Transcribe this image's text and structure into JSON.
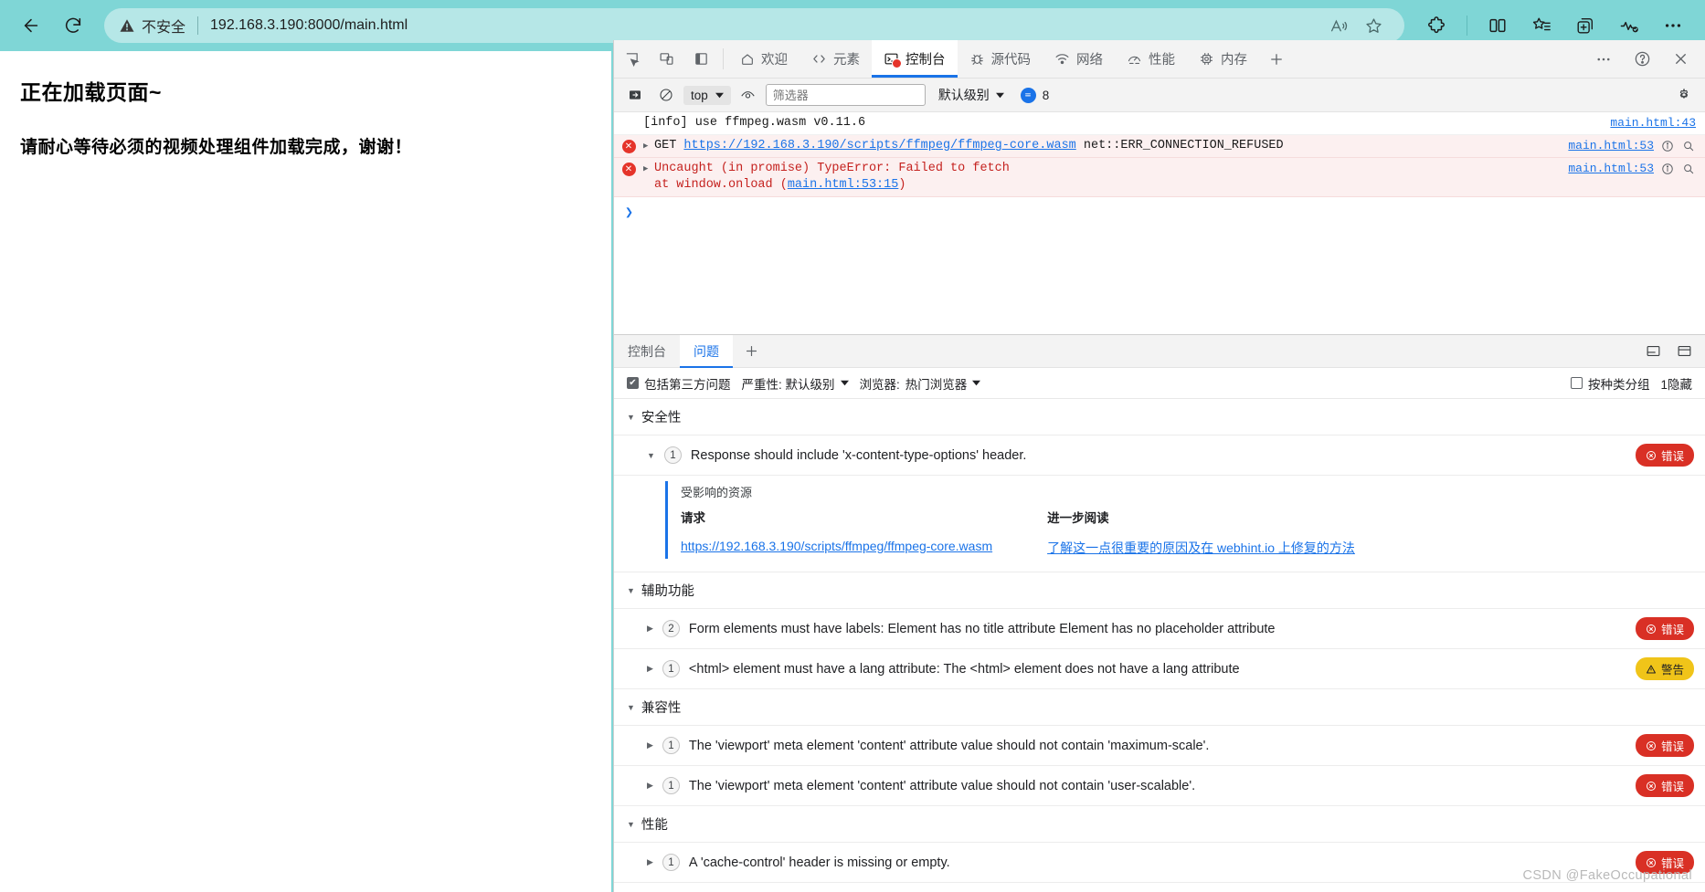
{
  "browser": {
    "back_label": "back-arrow",
    "reload_label": "reload",
    "security_text": "不安全",
    "url": "192.168.3.190:8000/main.html",
    "read_aloud_icon": "read-aloud-icon",
    "favorite_icon": "star-icon",
    "toolbar_icons": [
      "extensions-icon",
      "split-screen-icon",
      "favorites-list-icon",
      "collections-icon",
      "browser-essentials-icon",
      "more-options-icon"
    ]
  },
  "page": {
    "heading": "正在加载页面~",
    "subheading": "请耐心等待必须的视频处理组件加载完成，谢谢！"
  },
  "devtools": {
    "left_icons": [
      "inspect-icon",
      "device-toolbar-icon",
      "dock-side-icon"
    ],
    "tabs": [
      {
        "label": "欢迎",
        "icon": "home-icon",
        "active": false
      },
      {
        "label": "元素",
        "icon": "code-icon",
        "active": false
      },
      {
        "label": "控制台",
        "icon": "console-icon",
        "active": true,
        "error": true
      },
      {
        "label": "源代码",
        "icon": "bug-icon",
        "active": false
      },
      {
        "label": "网络",
        "icon": "network-icon",
        "active": false
      },
      {
        "label": "性能",
        "icon": "performance-icon",
        "active": false
      },
      {
        "label": "内存",
        "icon": "memory-icon",
        "active": false
      }
    ],
    "add_tab": "+",
    "more_tools": "more-tools-icon",
    "help": "help-icon",
    "close": "close-icon"
  },
  "console_toolbar": {
    "sidebar_toggle": "console-sidebar-icon",
    "clear": "clear-console-icon",
    "context": "top",
    "eye": "live-expression-icon",
    "filter_placeholder": "筛选器",
    "filter_value": "",
    "level": "默认级别",
    "info_count": "8",
    "settings": "settings-gear-icon"
  },
  "console_messages": [
    {
      "type": "info",
      "text": "[info] use ffmpeg.wasm v0.11.6",
      "source": "main.html:43",
      "expandable": false
    },
    {
      "type": "error",
      "prefix": "GET ",
      "link": "https://192.168.3.190/scripts/ffmpeg/ffmpeg-core.wasm",
      "suffix": " net::ERR_CONNECTION_REFUSED",
      "source": "main.html:53",
      "expandable": true
    },
    {
      "type": "error",
      "text": "Uncaught (in promise) TypeError: Failed to fetch",
      "sub_prefix": "    at window.onload (",
      "sub_link": "main.html:53:15",
      "sub_suffix": ")",
      "source": "main.html:53",
      "expandable": true
    }
  ],
  "drawer": {
    "tabs": [
      {
        "label": "控制台",
        "active": false
      },
      {
        "label": "问题",
        "active": true
      }
    ],
    "add_tab": "+",
    "right_icons": [
      "dock-bottom-icon",
      "dock-right-icon"
    ]
  },
  "issues_filter": {
    "third_party_label": "包括第三方问题",
    "third_party_checked": true,
    "severity_label": "严重性: 默认级别",
    "browser_label": "浏览器:",
    "browser_value": "热门浏览器",
    "group_by_kind_label": "按种类分组",
    "group_by_kind_checked": false,
    "hidden_label": "1隐藏"
  },
  "issues": [
    {
      "category": "安全性",
      "rows": [
        {
          "count": "1",
          "text": "Response should include 'x-content-type-options' header.",
          "badge": "错误",
          "badge_type": "error",
          "expanded": true,
          "detail": {
            "affected_label": "受影响的资源",
            "col1_head": "请求",
            "col1_link": "https://192.168.3.190/scripts/ffmpeg/ffmpeg-core.wasm",
            "col2_head": "进一步阅读",
            "col2_link": "了解这一点很重要的原因及在 webhint.io 上修复的方法"
          }
        }
      ]
    },
    {
      "category": "辅助功能",
      "rows": [
        {
          "count": "2",
          "text": "Form elements must have labels: Element has no title attribute Element has no placeholder attribute",
          "badge": "错误",
          "badge_type": "error",
          "expanded": false
        },
        {
          "count": "1",
          "text": "<html> element must have a lang attribute: The <html> element does not have a lang attribute",
          "badge": "警告",
          "badge_type": "warn",
          "expanded": false
        }
      ]
    },
    {
      "category": "兼容性",
      "rows": [
        {
          "count": "1",
          "text": "The 'viewport' meta element 'content' attribute value should not contain 'maximum-scale'.",
          "badge": "错误",
          "badge_type": "error",
          "expanded": false
        },
        {
          "count": "1",
          "text": "The 'viewport' meta element 'content' attribute value should not contain 'user-scalable'.",
          "badge": "错误",
          "badge_type": "error",
          "expanded": false
        }
      ]
    },
    {
      "category": "性能",
      "rows": [
        {
          "count": "1",
          "text": "A 'cache-control' header is missing or empty.",
          "badge": "错误",
          "badge_type": "error",
          "expanded": false
        }
      ]
    }
  ],
  "watermark": "CSDN @FakeOccupational",
  "colors": {
    "chrome_bg": "#7fd6d6",
    "accent_blue": "#1a73e8",
    "error_red": "#d93025",
    "warn_yellow": "#f0c419"
  }
}
